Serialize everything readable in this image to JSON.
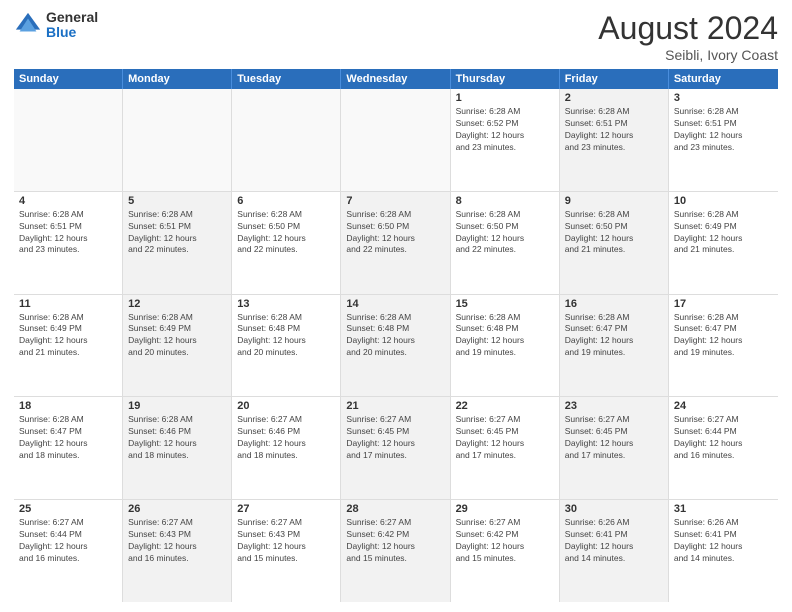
{
  "logo": {
    "general": "General",
    "blue": "Blue"
  },
  "title": "August 2024",
  "location": "Seibli, Ivory Coast",
  "header_days": [
    "Sunday",
    "Monday",
    "Tuesday",
    "Wednesday",
    "Thursday",
    "Friday",
    "Saturday"
  ],
  "weeks": [
    [
      {
        "day": "",
        "info": "",
        "empty": true
      },
      {
        "day": "",
        "info": "",
        "empty": true
      },
      {
        "day": "",
        "info": "",
        "empty": true
      },
      {
        "day": "",
        "info": "",
        "empty": true
      },
      {
        "day": "1",
        "info": "Sunrise: 6:28 AM\nSunset: 6:52 PM\nDaylight: 12 hours\nand 23 minutes.",
        "empty": false
      },
      {
        "day": "2",
        "info": "Sunrise: 6:28 AM\nSunset: 6:51 PM\nDaylight: 12 hours\nand 23 minutes.",
        "empty": false
      },
      {
        "day": "3",
        "info": "Sunrise: 6:28 AM\nSunset: 6:51 PM\nDaylight: 12 hours\nand 23 minutes.",
        "empty": false
      }
    ],
    [
      {
        "day": "4",
        "info": "Sunrise: 6:28 AM\nSunset: 6:51 PM\nDaylight: 12 hours\nand 23 minutes.",
        "empty": false
      },
      {
        "day": "5",
        "info": "Sunrise: 6:28 AM\nSunset: 6:51 PM\nDaylight: 12 hours\nand 22 minutes.",
        "empty": false
      },
      {
        "day": "6",
        "info": "Sunrise: 6:28 AM\nSunset: 6:50 PM\nDaylight: 12 hours\nand 22 minutes.",
        "empty": false
      },
      {
        "day": "7",
        "info": "Sunrise: 6:28 AM\nSunset: 6:50 PM\nDaylight: 12 hours\nand 22 minutes.",
        "empty": false
      },
      {
        "day": "8",
        "info": "Sunrise: 6:28 AM\nSunset: 6:50 PM\nDaylight: 12 hours\nand 22 minutes.",
        "empty": false
      },
      {
        "day": "9",
        "info": "Sunrise: 6:28 AM\nSunset: 6:50 PM\nDaylight: 12 hours\nand 21 minutes.",
        "empty": false
      },
      {
        "day": "10",
        "info": "Sunrise: 6:28 AM\nSunset: 6:49 PM\nDaylight: 12 hours\nand 21 minutes.",
        "empty": false
      }
    ],
    [
      {
        "day": "11",
        "info": "Sunrise: 6:28 AM\nSunset: 6:49 PM\nDaylight: 12 hours\nand 21 minutes.",
        "empty": false
      },
      {
        "day": "12",
        "info": "Sunrise: 6:28 AM\nSunset: 6:49 PM\nDaylight: 12 hours\nand 20 minutes.",
        "empty": false
      },
      {
        "day": "13",
        "info": "Sunrise: 6:28 AM\nSunset: 6:48 PM\nDaylight: 12 hours\nand 20 minutes.",
        "empty": false
      },
      {
        "day": "14",
        "info": "Sunrise: 6:28 AM\nSunset: 6:48 PM\nDaylight: 12 hours\nand 20 minutes.",
        "empty": false
      },
      {
        "day": "15",
        "info": "Sunrise: 6:28 AM\nSunset: 6:48 PM\nDaylight: 12 hours\nand 19 minutes.",
        "empty": false
      },
      {
        "day": "16",
        "info": "Sunrise: 6:28 AM\nSunset: 6:47 PM\nDaylight: 12 hours\nand 19 minutes.",
        "empty": false
      },
      {
        "day": "17",
        "info": "Sunrise: 6:28 AM\nSunset: 6:47 PM\nDaylight: 12 hours\nand 19 minutes.",
        "empty": false
      }
    ],
    [
      {
        "day": "18",
        "info": "Sunrise: 6:28 AM\nSunset: 6:47 PM\nDaylight: 12 hours\nand 18 minutes.",
        "empty": false
      },
      {
        "day": "19",
        "info": "Sunrise: 6:28 AM\nSunset: 6:46 PM\nDaylight: 12 hours\nand 18 minutes.",
        "empty": false
      },
      {
        "day": "20",
        "info": "Sunrise: 6:27 AM\nSunset: 6:46 PM\nDaylight: 12 hours\nand 18 minutes.",
        "empty": false
      },
      {
        "day": "21",
        "info": "Sunrise: 6:27 AM\nSunset: 6:45 PM\nDaylight: 12 hours\nand 17 minutes.",
        "empty": false
      },
      {
        "day": "22",
        "info": "Sunrise: 6:27 AM\nSunset: 6:45 PM\nDaylight: 12 hours\nand 17 minutes.",
        "empty": false
      },
      {
        "day": "23",
        "info": "Sunrise: 6:27 AM\nSunset: 6:45 PM\nDaylight: 12 hours\nand 17 minutes.",
        "empty": false
      },
      {
        "day": "24",
        "info": "Sunrise: 6:27 AM\nSunset: 6:44 PM\nDaylight: 12 hours\nand 16 minutes.",
        "empty": false
      }
    ],
    [
      {
        "day": "25",
        "info": "Sunrise: 6:27 AM\nSunset: 6:44 PM\nDaylight: 12 hours\nand 16 minutes.",
        "empty": false
      },
      {
        "day": "26",
        "info": "Sunrise: 6:27 AM\nSunset: 6:43 PM\nDaylight: 12 hours\nand 16 minutes.",
        "empty": false
      },
      {
        "day": "27",
        "info": "Sunrise: 6:27 AM\nSunset: 6:43 PM\nDaylight: 12 hours\nand 15 minutes.",
        "empty": false
      },
      {
        "day": "28",
        "info": "Sunrise: 6:27 AM\nSunset: 6:42 PM\nDaylight: 12 hours\nand 15 minutes.",
        "empty": false
      },
      {
        "day": "29",
        "info": "Sunrise: 6:27 AM\nSunset: 6:42 PM\nDaylight: 12 hours\nand 15 minutes.",
        "empty": false
      },
      {
        "day": "30",
        "info": "Sunrise: 6:26 AM\nSunset: 6:41 PM\nDaylight: 12 hours\nand 14 minutes.",
        "empty": false
      },
      {
        "day": "31",
        "info": "Sunrise: 6:26 AM\nSunset: 6:41 PM\nDaylight: 12 hours\nand 14 minutes.",
        "empty": false
      }
    ]
  ]
}
